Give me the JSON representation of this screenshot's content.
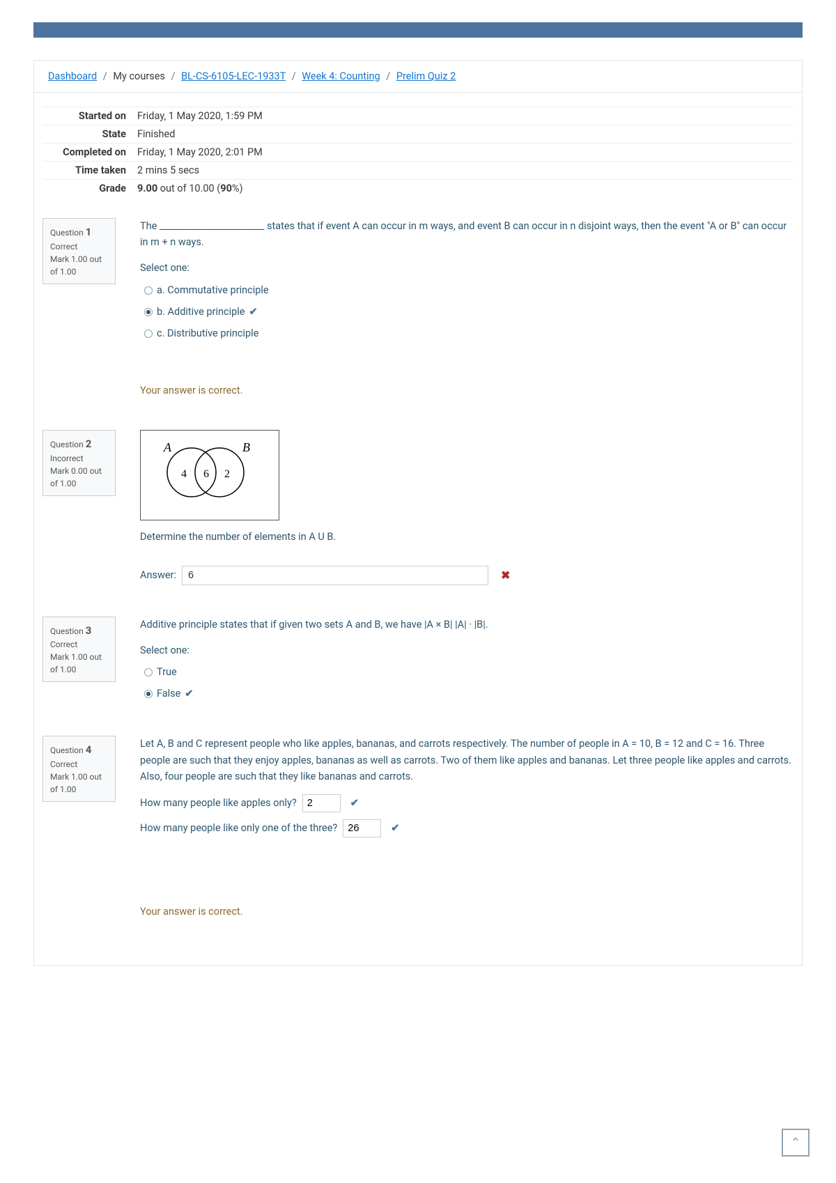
{
  "breadcrumb": {
    "dashboard": "Dashboard",
    "mycourses": "My courses",
    "course": "BL-CS-6105-LEC-1933T",
    "section": "Week 4: Counting",
    "quiz": "Prelim Quiz 2"
  },
  "summary": {
    "started_label": "Started on",
    "started_val": "Friday, 1 May 2020, 1:59 PM",
    "state_label": "State",
    "state_val": "Finished",
    "completed_label": "Completed on",
    "completed_val": "Friday, 1 May 2020, 2:01 PM",
    "time_label": "Time taken",
    "time_val": "2 mins 5 secs",
    "grade_label": "Grade",
    "grade_strong": "9.00",
    "grade_mid": " out of 10.00 (",
    "grade_pct": "90",
    "grade_end": "%)"
  },
  "q1": {
    "qlabel": "Question ",
    "qnum": "1",
    "state": "Correct",
    "mark": "Mark 1.00 out of 1.00",
    "text": "The _______________________ states that if event A can occur in m ways, and event B can occur in n disjoint ways, then the event \"A or B\" can occur in m + n ways.",
    "select": "Select one:",
    "a": "a. Commutative principle",
    "b": "b. Additive principle",
    "c": "c. Distributive principle",
    "feedback": "Your answer is correct."
  },
  "q2": {
    "qlabel": "Question ",
    "qnum": "2",
    "state": "Incorrect",
    "mark": "Mark 0.00 out of 1.00",
    "venn": {
      "A": "A",
      "B": "B",
      "left": "4",
      "mid": "6",
      "right": "2"
    },
    "text": "Determine the number of elements in A U B.",
    "answer_label": "Answer:",
    "answer_val": "6"
  },
  "q3": {
    "qlabel": "Question ",
    "qnum": "3",
    "state": "Correct",
    "mark": "Mark 1.00 out of 1.00",
    "text": "Additive principle states that if given two sets A and B, we have |A × B| |A| · |B|.",
    "select": "Select one:",
    "t": "True",
    "f": "False"
  },
  "q4": {
    "qlabel": "Question ",
    "qnum": "4",
    "state": "Correct",
    "mark": "Mark 1.00 out of 1.00",
    "text": "Let A, B and C represent people who like apples, bananas, and carrots respectively. The number of people in A = 10, B = 12 and C = 16. Three people are such that they enjoy apples, bananas as well as carrots. Two of them like apples and bananas. Let three people like apples and carrots. Also, four people are such that they like bananas and carrots.",
    "p1": "How many people like apples only?",
    "v1": "2",
    "p2": "How many people like only one of the three?",
    "v2": "26",
    "feedback": "Your answer is correct."
  }
}
